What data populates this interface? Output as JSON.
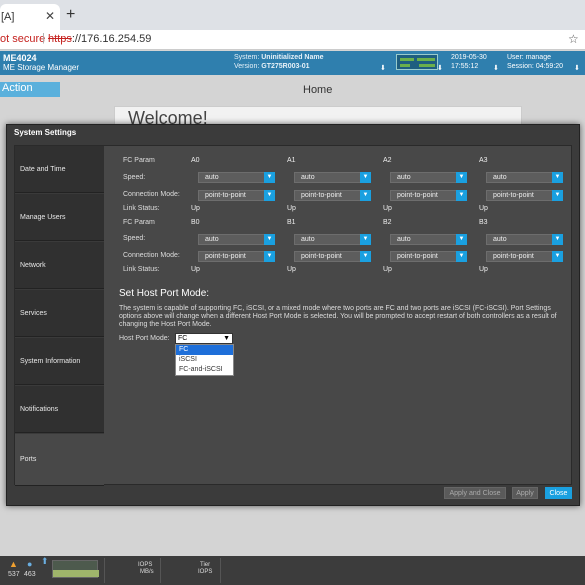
{
  "browser": {
    "tab_title": "[A]",
    "not_secure": "ot secure",
    "url_scheme": "https",
    "url_rest": "://176.16.254.59"
  },
  "header": {
    "product": "ME4024",
    "product_sub": "ME Storage Manager",
    "system_label": "System:",
    "system_name": "Uninitialized Name",
    "version_label": "Version:",
    "version": "GT275R003-01",
    "date": "2019-05-30",
    "time": "17:55:12",
    "user_label": "User:",
    "user": "manage",
    "session_label": "Session:",
    "session": "04:59:20"
  },
  "background": {
    "action": "Action",
    "home": "Home",
    "welcome": "Welcome!"
  },
  "modal": {
    "title": "System Settings",
    "nav": [
      {
        "label": "Date and Time"
      },
      {
        "label": "Manage Users"
      },
      {
        "label": "Network"
      },
      {
        "label": "Services"
      },
      {
        "label": "System Information"
      },
      {
        "label": "Notifications"
      },
      {
        "label": "Ports"
      }
    ],
    "labels": {
      "fc_param": "FC Param",
      "speed": "Speed:",
      "connection_mode": "Connection Mode:",
      "link_status": "Link Status:"
    },
    "port_groups": [
      {
        "ports": [
          {
            "name": "A0",
            "speed": "auto",
            "mode": "point-to-point",
            "link": "Up"
          },
          {
            "name": "A1",
            "speed": "auto",
            "mode": "point-to-point",
            "link": "Up"
          },
          {
            "name": "A2",
            "speed": "auto",
            "mode": "point-to-point",
            "link": "Up"
          },
          {
            "name": "A3",
            "speed": "auto",
            "mode": "point-to-point",
            "link": "Up"
          }
        ]
      },
      {
        "ports": [
          {
            "name": "B0",
            "speed": "auto",
            "mode": "point-to-point",
            "link": "Up"
          },
          {
            "name": "B1",
            "speed": "auto",
            "mode": "point-to-point",
            "link": "Up"
          },
          {
            "name": "B2",
            "speed": "auto",
            "mode": "point-to-point",
            "link": "Up"
          },
          {
            "name": "B3",
            "speed": "auto",
            "mode": "point-to-point",
            "link": "Up"
          }
        ]
      }
    ],
    "host_port": {
      "section_title": "Set Host Port Mode:",
      "description": "The system is capable of supporting FC, iSCSI, or a mixed mode where two ports are FC and two ports are iSCSI (FC-iSCSI). Port Settings options above will change when a different Host Port Mode is selected. You will be prompted to accept restart of both controllers as a result of changing the Host Port Mode.",
      "label": "Host Port Mode:",
      "value": "FC",
      "options": [
        "FC",
        "iSCSI",
        "FC-and-iSCSI"
      ]
    },
    "buttons": {
      "apply_close": "Apply and Close",
      "apply": "Apply",
      "close": "Close"
    }
  },
  "footer": {
    "warn_count": "537",
    "info_count": "463",
    "iops": "IOPS",
    "mbs": "MB/s",
    "tier": "Tier",
    "tier_iops": "IOPS"
  },
  "colors": {
    "header": "#2f7fae",
    "accent": "#1aa0e0",
    "modal_bg": "#3b3b3b"
  }
}
